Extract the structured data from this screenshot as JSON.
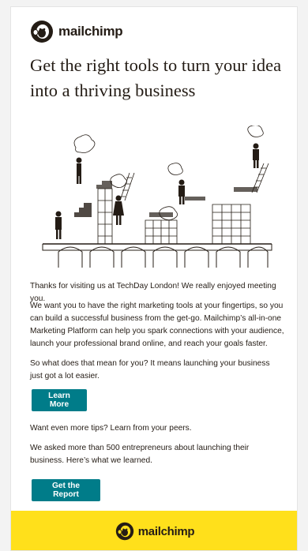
{
  "brand": {
    "name": "mailchimp",
    "icon": "mailchimp-freddie-logo-icon"
  },
  "headline": "Get the right tools to turn your idea into a thriving business",
  "illustration": {
    "icon": "people-building-bridge-illustration-icon"
  },
  "body": {
    "p1": "Thanks for visiting us at TechDay London! We really enjoyed meeting you.",
    "p2": "We want you to have the right marketing tools at your fingertips, so you can build a successful business from the get-go. Mailchimp’s all-in-one Marketing Platform can help you spark connections with your audience, launch your professional brand online, and reach your goals faster.",
    "p3": "So what does that mean for you? It means launching your business just got a lot easier.",
    "p4": "Want even more tips? Learn from your peers.",
    "p5": "We asked more than 500 entrepreneurs about launching their business. Here’s what we learned."
  },
  "buttons": {
    "learn_more": "Learn More",
    "get_report": "Get the Report"
  },
  "footer": {
    "name": "mailchimp"
  },
  "colors": {
    "accent": "#007c89",
    "footer": "#ffe01b",
    "text": "#241c15"
  }
}
